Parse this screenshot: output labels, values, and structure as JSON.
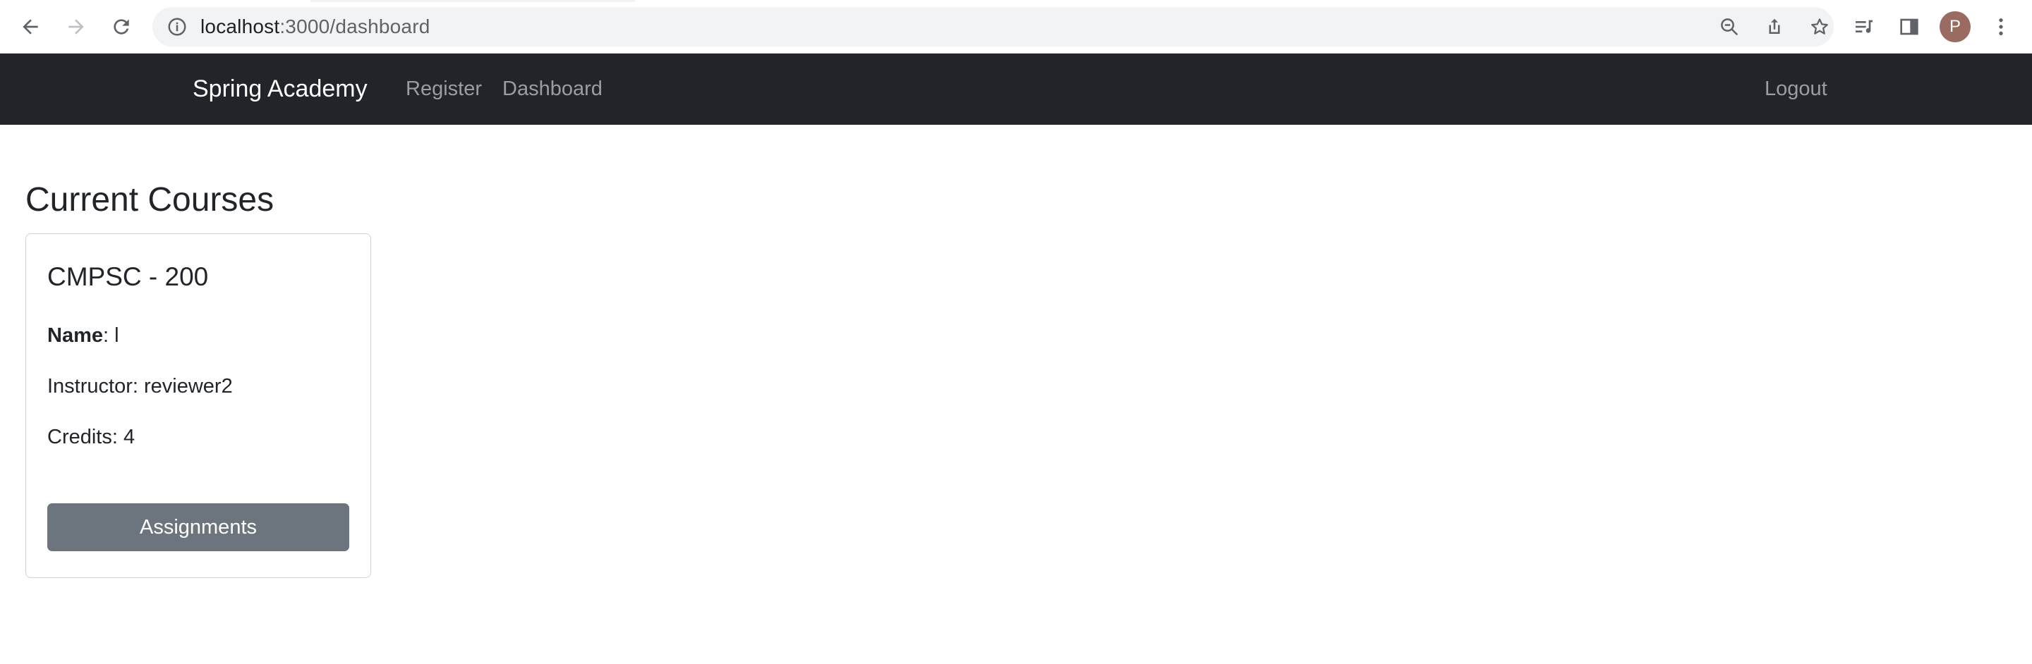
{
  "browser": {
    "url_host": "localhost",
    "url_path": ":3000/dashboard",
    "profile_initial": "P"
  },
  "navbar": {
    "brand": "Spring Academy",
    "links": [
      "Register",
      "Dashboard"
    ],
    "logout": "Logout"
  },
  "main": {
    "title": "Current Courses",
    "courses": [
      {
        "code": "CMPSC - 200",
        "name_label": "Name",
        "name_value": ": l",
        "instructor": "Instructor: reviewer2",
        "credits": "Credits: 4",
        "button": "Assignments"
      }
    ]
  },
  "colors": {
    "navbar_bg": "#212529",
    "button_secondary": "#6c757d",
    "avatar": "#9a6b61"
  }
}
